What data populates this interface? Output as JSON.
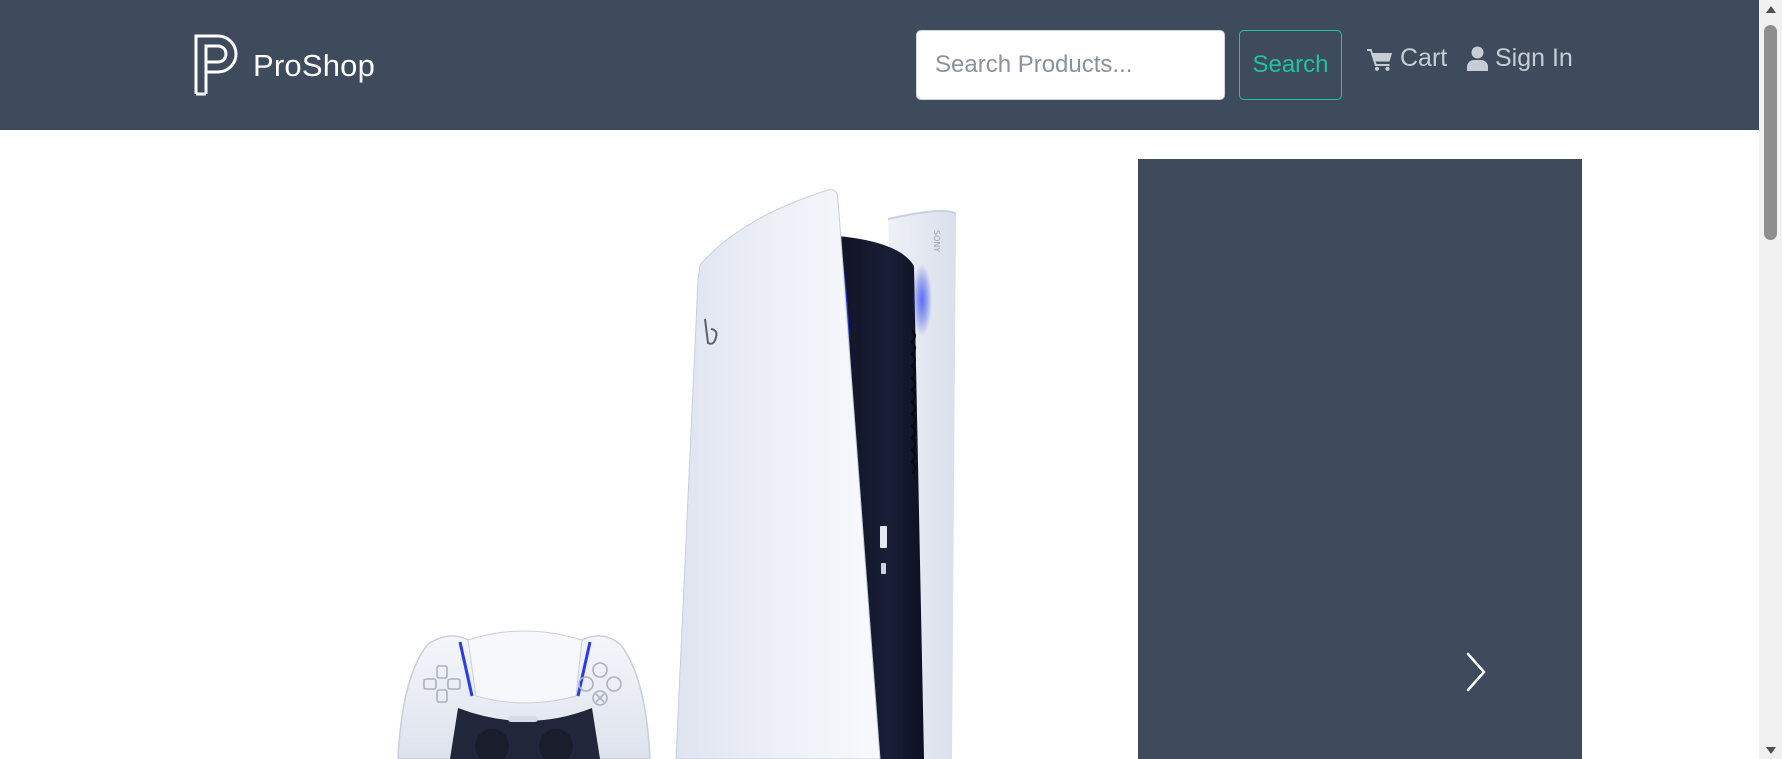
{
  "navbar": {
    "brand_name": "ProShop",
    "search": {
      "placeholder": "Search Products...",
      "value": "",
      "button_label": "Search"
    },
    "cart_label": "Cart",
    "signin_label": "Sign In"
  },
  "carousel": {
    "active_index": 0,
    "next_icon": "chevron-right-icon"
  },
  "icons": {
    "brand": "proshop-logo",
    "cart": "cart-icon",
    "signin": "user-icon"
  },
  "colors": {
    "navbar_bg": "#3d4b5c",
    "accent": "#1fc4a0",
    "nav_link": "#c7cdd4",
    "panel_bg": "#3d4b5c"
  }
}
